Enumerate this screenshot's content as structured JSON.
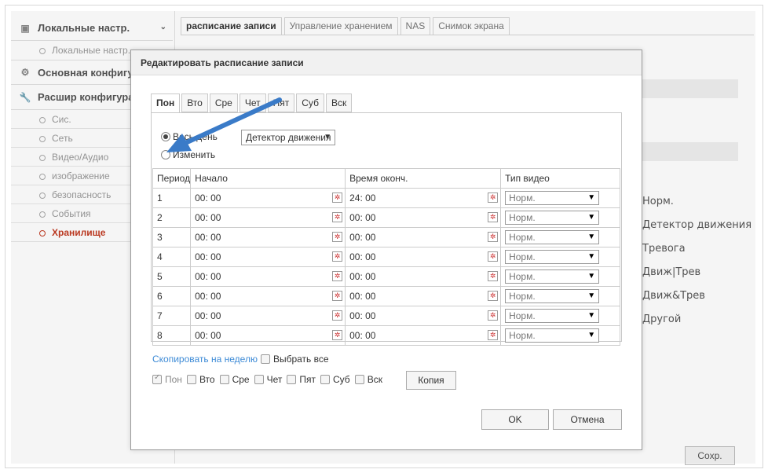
{
  "sidebar": {
    "local": {
      "label": "Локальные настр.",
      "sub": "Локальные настр."
    },
    "basic": {
      "label": "Основная конфигурация"
    },
    "advanced": {
      "label": "Расшир конфигурация"
    },
    "items": [
      "Сис.",
      "Сеть",
      "Видео/Аудио",
      "изображение",
      "безопасность",
      "События",
      "Хранилище"
    ]
  },
  "tabs": [
    "расписание записи",
    "Управление хранением",
    "NAS",
    "Снимок экрана"
  ],
  "legend": [
    "Норм.",
    "Детектор движения",
    "Тревога",
    "Движ|Трев",
    "Движ&Трев",
    "Другой"
  ],
  "save_label": "Сохр.",
  "modal": {
    "title": "Редактировать расписание записи",
    "days": [
      "Пон",
      "Вто",
      "Сре",
      "Чет",
      "Пят",
      "Суб",
      "Вск"
    ],
    "radio_all": "Весь день",
    "radio_custom": "Изменить",
    "mode_select": "Детектор движения",
    "columns": [
      "Период",
      "Начало",
      "Время оконч.",
      "Тип видео"
    ],
    "rows": [
      {
        "n": "1",
        "start": "00: 00",
        "end": "24: 00",
        "type": "Норм."
      },
      {
        "n": "2",
        "start": "00: 00",
        "end": "00: 00",
        "type": "Норм."
      },
      {
        "n": "3",
        "start": "00: 00",
        "end": "00: 00",
        "type": "Норм."
      },
      {
        "n": "4",
        "start": "00: 00",
        "end": "00: 00",
        "type": "Норм."
      },
      {
        "n": "5",
        "start": "00: 00",
        "end": "00: 00",
        "type": "Норм."
      },
      {
        "n": "6",
        "start": "00: 00",
        "end": "00: 00",
        "type": "Норм."
      },
      {
        "n": "7",
        "start": "00: 00",
        "end": "00: 00",
        "type": "Норм."
      },
      {
        "n": "8",
        "start": "00: 00",
        "end": "00: 00",
        "type": "Норм."
      }
    ],
    "copy_week": "Скопировать на неделю",
    "select_all": "Выбрать все",
    "copy_label": "Копия",
    "ok_label": "OK",
    "cancel_label": "Отмена"
  },
  "colors": {
    "accent": "#c23b22",
    "link": "#3c8ad6",
    "arrow": "#3a7bc8"
  }
}
